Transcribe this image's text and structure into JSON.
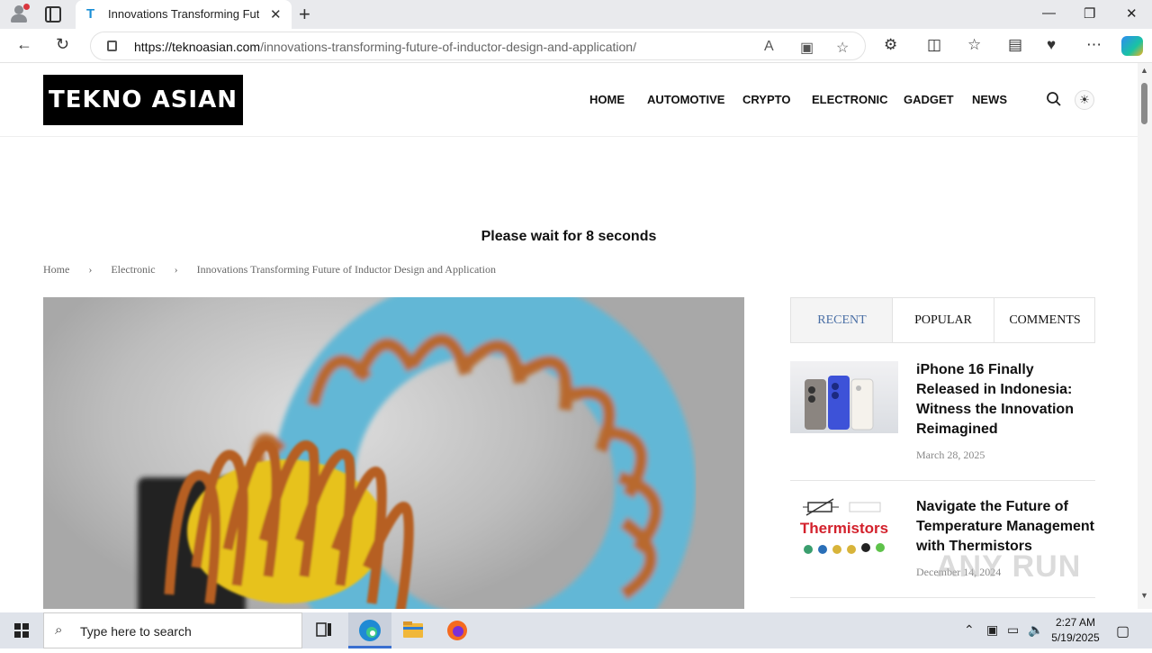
{
  "browser": {
    "tab_title": "Innovations Transforming Future of Inductor Design and Application",
    "tab_favicon": "T",
    "url_domain": "https://teknoasian.com",
    "url_path": "/innovations-transforming-future-of-inductor-design-and-application/"
  },
  "site": {
    "logo_text": "TEKNO ASIAN",
    "menu": [
      "HOME",
      "AUTOMOTIVE",
      "CRYPTO",
      "ELECTRONIC",
      "GADGET",
      "NEWS"
    ],
    "wait_text": "Please wait for 8 seconds",
    "breadcrumb": [
      "Home",
      "Electronic",
      "Innovations Transforming Future of Inductor Design and Application"
    ]
  },
  "sidebar": {
    "tabs": [
      "RECENT",
      "POPULAR",
      "COMMENTS"
    ],
    "posts": [
      {
        "title": "iPhone 16 Finally Released in Indonesia: Witness the Innovation Reimagined",
        "date": "March 28, 2025"
      },
      {
        "title": "Navigate the Future of Temperature Management with Thermistors",
        "date": "December 14, 2024",
        "thumb_label": "Thermistors"
      }
    ]
  },
  "watermark": "ANY RUN",
  "taskbar": {
    "search_placeholder": "Type here to search",
    "time": "2:27 AM",
    "date": "5/19/2025"
  },
  "colors": {
    "active_tab_text": "#4a6fa5",
    "logo_bg": "#000000"
  }
}
